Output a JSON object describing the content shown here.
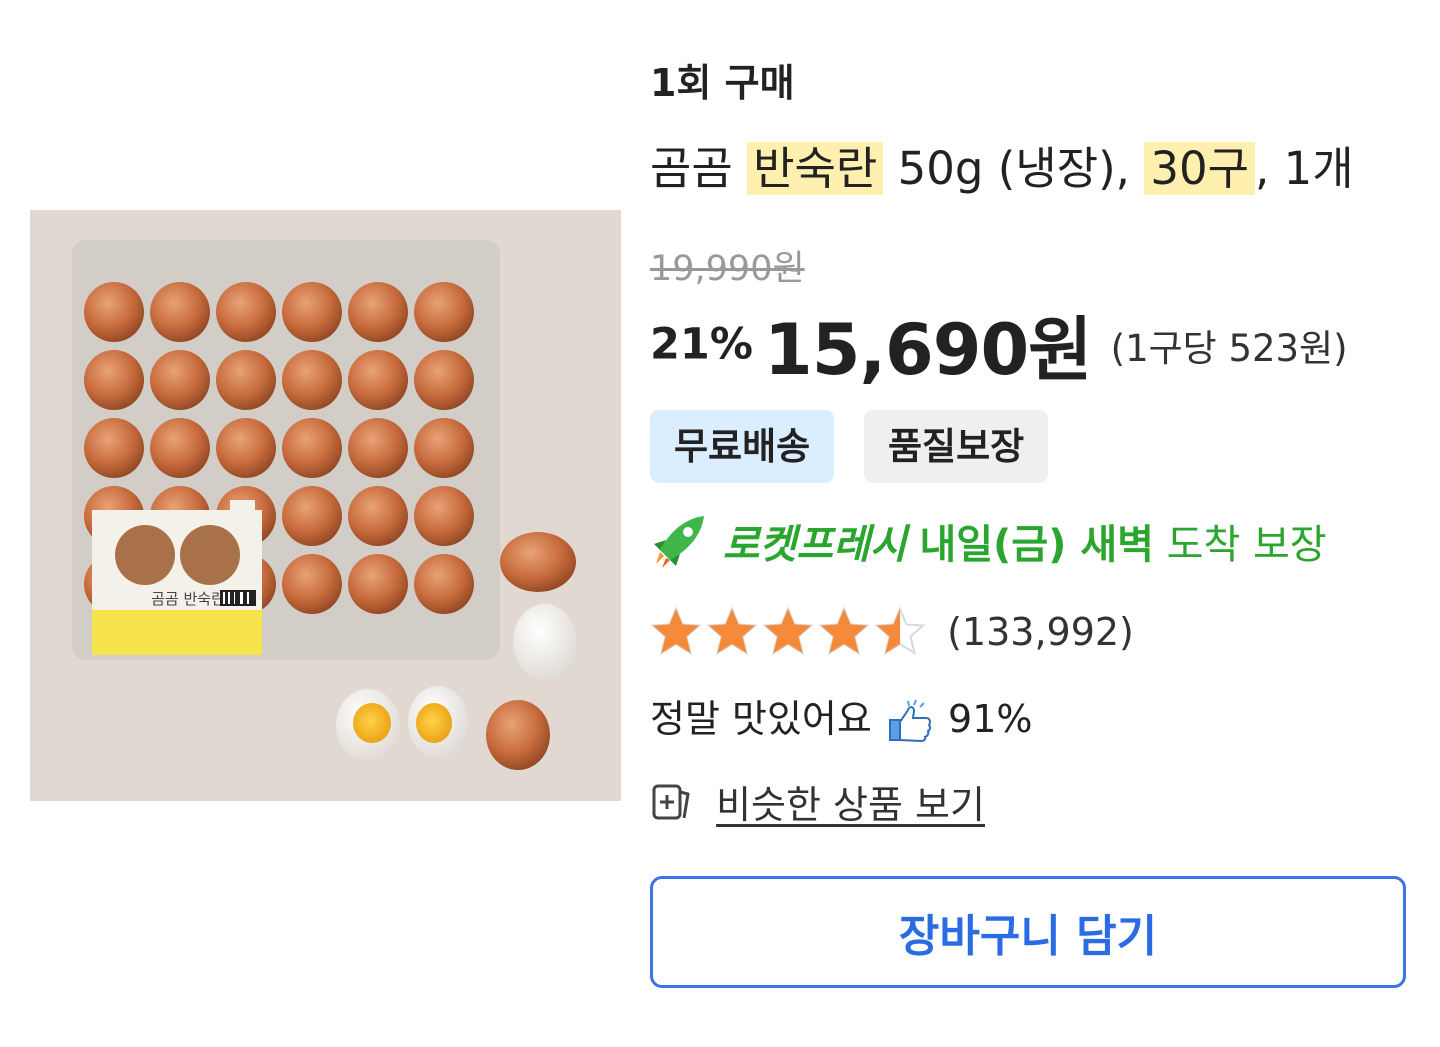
{
  "purchase_type": "1회 구매",
  "title": {
    "part1": "곰곰",
    "hl1": "반숙란",
    "part2": "50g (냉장),",
    "hl2": "30구",
    "part3": ", 1개"
  },
  "price": {
    "original": "19,990원",
    "discount": "21%",
    "sale": "15,690원",
    "unit": "(1구당 523원)"
  },
  "badges": {
    "free_shipping": "무료배송",
    "quality": "품질보장"
  },
  "delivery": {
    "brand": "로켓프레시",
    "date": "내일(금) 새벽",
    "rest": "도착 보장",
    "color": "#2aa52d"
  },
  "rating": {
    "stars": 4.5,
    "max": 5,
    "count": "(133,992)",
    "star_color": "#f7893a"
  },
  "taste": {
    "label": "정말 맛있어요",
    "percent": "91%"
  },
  "similar": {
    "label": "비슷한 상품 보기",
    "icon": "similar-product-icon"
  },
  "cart": {
    "label": "장바구니 담기",
    "color": "#2b6be4"
  },
  "image": {
    "product_label": "곰곰 반숙란",
    "egg_count": 30
  }
}
